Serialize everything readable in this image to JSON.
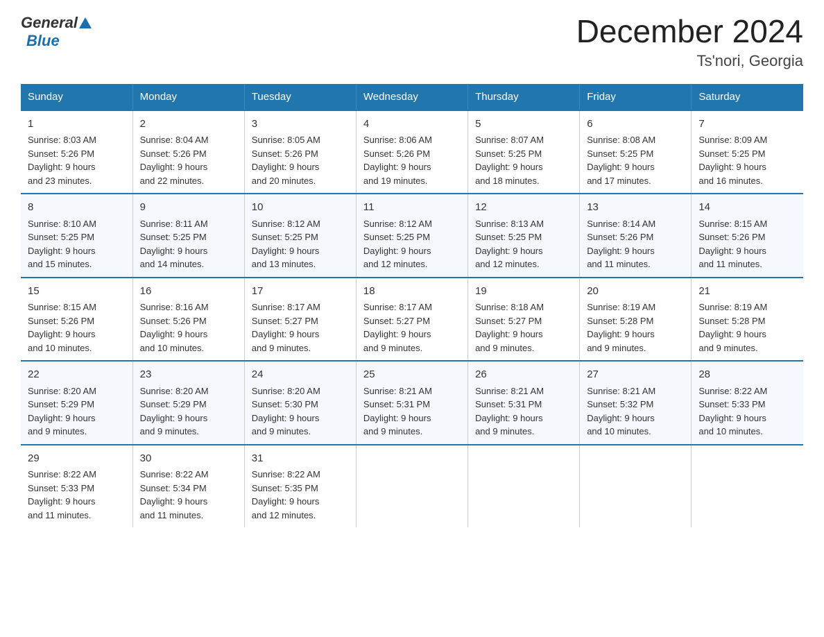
{
  "logo": {
    "general": "General",
    "blue": "Blue",
    "triangle": "▲"
  },
  "title": "December 2024",
  "subtitle": "Ts'nori, Georgia",
  "weekdays": [
    "Sunday",
    "Monday",
    "Tuesday",
    "Wednesday",
    "Thursday",
    "Friday",
    "Saturday"
  ],
  "weeks": [
    [
      {
        "day": "1",
        "info": "Sunrise: 8:03 AM\nSunset: 5:26 PM\nDaylight: 9 hours\nand 23 minutes."
      },
      {
        "day": "2",
        "info": "Sunrise: 8:04 AM\nSunset: 5:26 PM\nDaylight: 9 hours\nand 22 minutes."
      },
      {
        "day": "3",
        "info": "Sunrise: 8:05 AM\nSunset: 5:26 PM\nDaylight: 9 hours\nand 20 minutes."
      },
      {
        "day": "4",
        "info": "Sunrise: 8:06 AM\nSunset: 5:26 PM\nDaylight: 9 hours\nand 19 minutes."
      },
      {
        "day": "5",
        "info": "Sunrise: 8:07 AM\nSunset: 5:25 PM\nDaylight: 9 hours\nand 18 minutes."
      },
      {
        "day": "6",
        "info": "Sunrise: 8:08 AM\nSunset: 5:25 PM\nDaylight: 9 hours\nand 17 minutes."
      },
      {
        "day": "7",
        "info": "Sunrise: 8:09 AM\nSunset: 5:25 PM\nDaylight: 9 hours\nand 16 minutes."
      }
    ],
    [
      {
        "day": "8",
        "info": "Sunrise: 8:10 AM\nSunset: 5:25 PM\nDaylight: 9 hours\nand 15 minutes."
      },
      {
        "day": "9",
        "info": "Sunrise: 8:11 AM\nSunset: 5:25 PM\nDaylight: 9 hours\nand 14 minutes."
      },
      {
        "day": "10",
        "info": "Sunrise: 8:12 AM\nSunset: 5:25 PM\nDaylight: 9 hours\nand 13 minutes."
      },
      {
        "day": "11",
        "info": "Sunrise: 8:12 AM\nSunset: 5:25 PM\nDaylight: 9 hours\nand 12 minutes."
      },
      {
        "day": "12",
        "info": "Sunrise: 8:13 AM\nSunset: 5:25 PM\nDaylight: 9 hours\nand 12 minutes."
      },
      {
        "day": "13",
        "info": "Sunrise: 8:14 AM\nSunset: 5:26 PM\nDaylight: 9 hours\nand 11 minutes."
      },
      {
        "day": "14",
        "info": "Sunrise: 8:15 AM\nSunset: 5:26 PM\nDaylight: 9 hours\nand 11 minutes."
      }
    ],
    [
      {
        "day": "15",
        "info": "Sunrise: 8:15 AM\nSunset: 5:26 PM\nDaylight: 9 hours\nand 10 minutes."
      },
      {
        "day": "16",
        "info": "Sunrise: 8:16 AM\nSunset: 5:26 PM\nDaylight: 9 hours\nand 10 minutes."
      },
      {
        "day": "17",
        "info": "Sunrise: 8:17 AM\nSunset: 5:27 PM\nDaylight: 9 hours\nand 9 minutes."
      },
      {
        "day": "18",
        "info": "Sunrise: 8:17 AM\nSunset: 5:27 PM\nDaylight: 9 hours\nand 9 minutes."
      },
      {
        "day": "19",
        "info": "Sunrise: 8:18 AM\nSunset: 5:27 PM\nDaylight: 9 hours\nand 9 minutes."
      },
      {
        "day": "20",
        "info": "Sunrise: 8:19 AM\nSunset: 5:28 PM\nDaylight: 9 hours\nand 9 minutes."
      },
      {
        "day": "21",
        "info": "Sunrise: 8:19 AM\nSunset: 5:28 PM\nDaylight: 9 hours\nand 9 minutes."
      }
    ],
    [
      {
        "day": "22",
        "info": "Sunrise: 8:20 AM\nSunset: 5:29 PM\nDaylight: 9 hours\nand 9 minutes."
      },
      {
        "day": "23",
        "info": "Sunrise: 8:20 AM\nSunset: 5:29 PM\nDaylight: 9 hours\nand 9 minutes."
      },
      {
        "day": "24",
        "info": "Sunrise: 8:20 AM\nSunset: 5:30 PM\nDaylight: 9 hours\nand 9 minutes."
      },
      {
        "day": "25",
        "info": "Sunrise: 8:21 AM\nSunset: 5:31 PM\nDaylight: 9 hours\nand 9 minutes."
      },
      {
        "day": "26",
        "info": "Sunrise: 8:21 AM\nSunset: 5:31 PM\nDaylight: 9 hours\nand 9 minutes."
      },
      {
        "day": "27",
        "info": "Sunrise: 8:21 AM\nSunset: 5:32 PM\nDaylight: 9 hours\nand 10 minutes."
      },
      {
        "day": "28",
        "info": "Sunrise: 8:22 AM\nSunset: 5:33 PM\nDaylight: 9 hours\nand 10 minutes."
      }
    ],
    [
      {
        "day": "29",
        "info": "Sunrise: 8:22 AM\nSunset: 5:33 PM\nDaylight: 9 hours\nand 11 minutes."
      },
      {
        "day": "30",
        "info": "Sunrise: 8:22 AM\nSunset: 5:34 PM\nDaylight: 9 hours\nand 11 minutes."
      },
      {
        "day": "31",
        "info": "Sunrise: 8:22 AM\nSunset: 5:35 PM\nDaylight: 9 hours\nand 12 minutes."
      },
      {
        "day": "",
        "info": ""
      },
      {
        "day": "",
        "info": ""
      },
      {
        "day": "",
        "info": ""
      },
      {
        "day": "",
        "info": ""
      }
    ]
  ]
}
